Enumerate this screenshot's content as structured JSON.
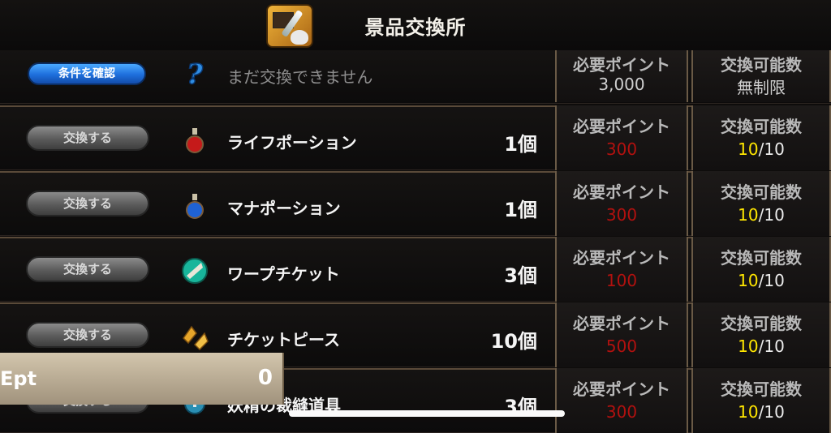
{
  "header": {
    "title": "景品交換所",
    "icon": "treasure-sword-icon"
  },
  "locked": {
    "button": "条件を確認",
    "icon": "question-icon",
    "message": "まだ交換できません",
    "points_label": "必要ポイント",
    "points": "3,000",
    "limit_label": "交換可能数",
    "limit": "無制限"
  },
  "items": [
    {
      "button": "交換する",
      "icon": "red-potion-icon",
      "name": "ライフポーション",
      "count": "1個",
      "points_label": "必要ポイント",
      "points": "300",
      "limit_label": "交換可能数",
      "qty_have": "10",
      "qty_total": "/10"
    },
    {
      "button": "交換する",
      "icon": "blue-potion-icon",
      "name": "マナポーション",
      "count": "1個",
      "points_label": "必要ポイント",
      "points": "300",
      "limit_label": "交換可能数",
      "qty_have": "10",
      "qty_total": "/10"
    },
    {
      "button": "交換する",
      "icon": "warp-ticket-icon",
      "name": "ワープチケット",
      "count": "3個",
      "points_label": "必要ポイント",
      "points": "100",
      "limit_label": "交換可能数",
      "qty_have": "10",
      "qty_total": "/10"
    },
    {
      "button": "交換する",
      "icon": "ticket-piece-icon",
      "name": "チケットピース",
      "count": "10個",
      "points_label": "必要ポイント",
      "points": "500",
      "limit_label": "交換可能数",
      "qty_have": "10",
      "qty_total": "/10"
    },
    {
      "button": "交換する",
      "icon": "sewing-tools-icon",
      "name": "妖精の裁縫道具",
      "count": "3個",
      "points_label": "必要ポイント",
      "points": "300",
      "limit_label": "交換可能数",
      "qty_have": "10",
      "qty_total": "/10"
    }
  ],
  "event_points": {
    "label": "Ept",
    "value": "0"
  },
  "colors": {
    "required_points": "#b1110f",
    "remaining": "#ffe600",
    "blue_button": "#1e6fdc"
  }
}
